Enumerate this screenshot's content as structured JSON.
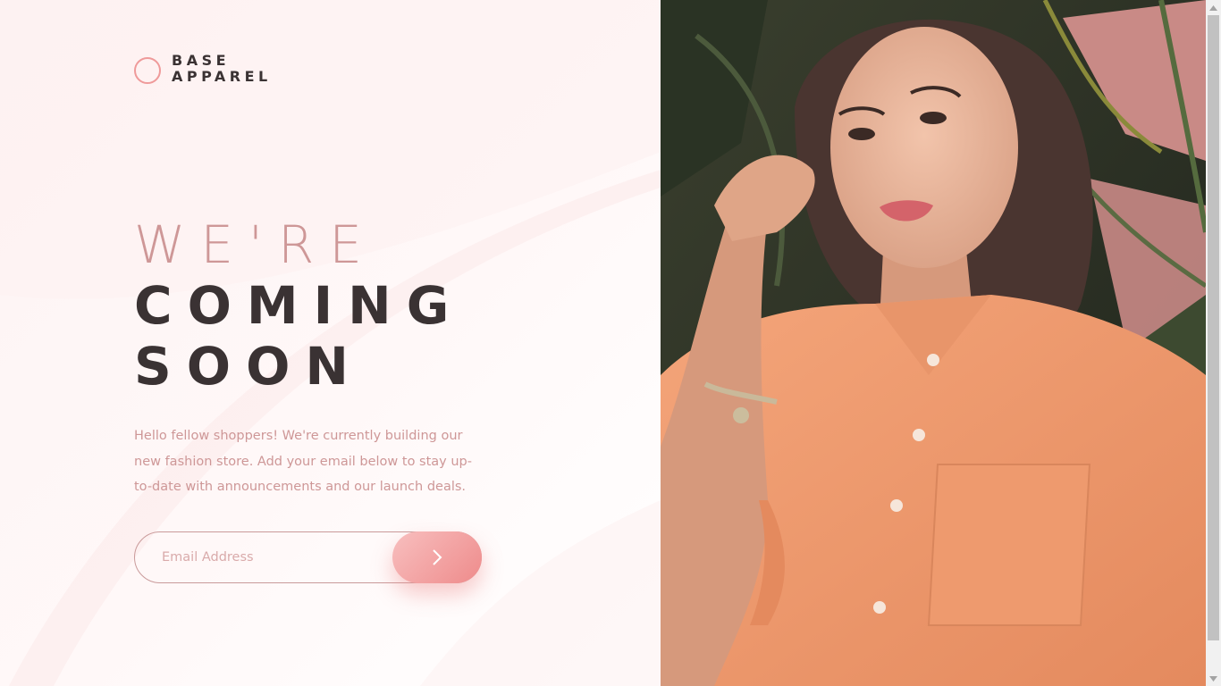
{
  "brand": {
    "line1": "BASE",
    "line2": "APPAREL",
    "accent_color": "#ef9a9a",
    "dark_color": "#3a3233"
  },
  "hero": {
    "line1": "WE'RE",
    "line2": "COMING",
    "line3": "SOON",
    "description": "Hello fellow shoppers! We're currently building our new fashion store. Add your email below to stay up-to-date with announcements and our launch deals."
  },
  "form": {
    "email_placeholder": "Email Address",
    "email_value": "",
    "submit_icon": "chevron-right-icon"
  },
  "photo": {
    "subject_icon": "model-photo"
  },
  "page_loading_progress": 0.2
}
